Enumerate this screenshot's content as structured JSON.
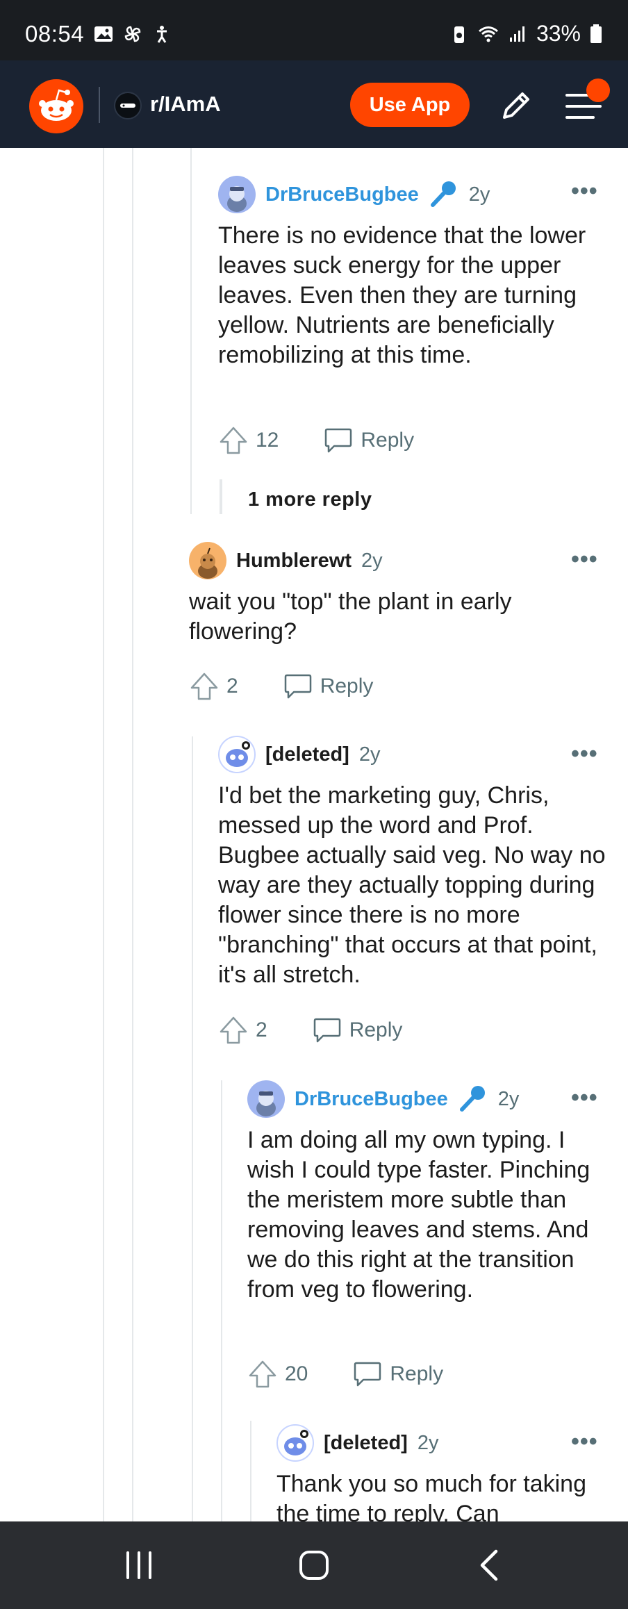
{
  "status_bar": {
    "time": "08:54",
    "battery": "33%",
    "icons": [
      "gallery-icon",
      "pinwheel-icon",
      "accessibility-icon",
      "battery-saver-icon",
      "wifi-icon",
      "signal-icon",
      "battery-icon"
    ]
  },
  "header": {
    "subreddit": "r/IAmA",
    "use_app_label": "Use App",
    "brand_color": "#ff4500"
  },
  "comments": [
    {
      "author": "DrBruceBugbee",
      "is_op": true,
      "age": "2y",
      "body": "There is no evidence that the lower leaves suck energy for the upper leaves. Even then they are turning yellow. Nutrients are beneficially remobilizing at this time.",
      "votes": "12",
      "reply_label": "Reply",
      "more_replies": "1 more reply"
    },
    {
      "author": "Humblerewt",
      "is_op": false,
      "age": "2y",
      "body": "wait you \"top\" the plant in early flowering?",
      "votes": "2",
      "reply_label": "Reply"
    },
    {
      "author": "[deleted]",
      "is_op": false,
      "age": "2y",
      "body": "I'd bet the marketing guy, Chris, messed up the word and Prof. Bugbee actually said veg. No way no way are they actually topping during flower since there is no more \"branching\" that occurs at that point, it's all stretch.",
      "votes": "2",
      "reply_label": "Reply"
    },
    {
      "author": "DrBruceBugbee",
      "is_op": true,
      "age": "2y",
      "body": "I am doing all my own typing. I wish I could type faster. Pinching the meristem more subtle than removing leaves and stems. And we do this right at the transition from veg to flowering.",
      "votes": "20",
      "reply_label": "Reply"
    },
    {
      "author": "[deleted]",
      "is_op": false,
      "age": "2y",
      "body": "Thank you so much for taking the time to reply. Can"
    }
  ],
  "colors": {
    "op_name": "#2f94dc",
    "meta_gray": "#576f76",
    "appbar_bg": "#1a2332"
  }
}
